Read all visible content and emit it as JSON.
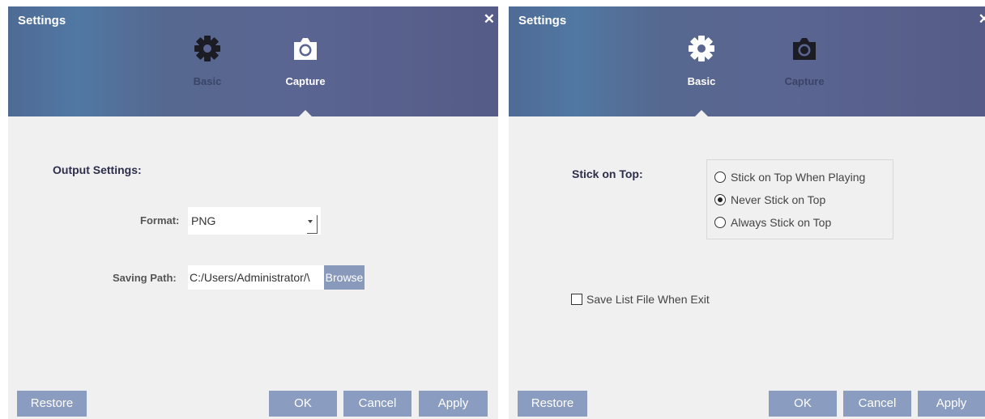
{
  "left": {
    "title": "Settings",
    "close_label": "✕",
    "tabs": [
      {
        "label": "Basic",
        "icon": "gear-icon",
        "active": false
      },
      {
        "label": "Capture",
        "icon": "camera-icon",
        "active": true
      }
    ],
    "section_heading": "Output Settings:",
    "format": {
      "label": "Format:",
      "value": "PNG"
    },
    "saving_path": {
      "label": "Saving Path:",
      "value": "C:/Users/Administrator/\\",
      "browse_label": "Browse"
    },
    "buttons": {
      "restore": "Restore",
      "ok": "OK",
      "cancel": "Cancel",
      "apply": "Apply"
    }
  },
  "right": {
    "title": "Settings",
    "close_label": "✕",
    "tabs": [
      {
        "label": "Basic",
        "icon": "gear-icon",
        "active": true
      },
      {
        "label": "Capture",
        "icon": "camera-icon",
        "active": false
      }
    ],
    "stick_on_top": {
      "label": "Stick on Top:",
      "options": [
        {
          "label": "Stick on Top When Playing",
          "selected": false
        },
        {
          "label": "Never Stick on Top",
          "selected": true
        },
        {
          "label": "Always Stick on Top",
          "selected": false
        }
      ]
    },
    "save_list": {
      "label": "Save List File When Exit",
      "checked": false
    },
    "buttons": {
      "restore": "Restore",
      "ok": "OK",
      "cancel": "Cancel",
      "apply": "Apply"
    }
  },
  "colors": {
    "header": "#5a6592",
    "body": "#f0f0f0",
    "button": "#8a9cc0",
    "browse": "#8899bb"
  }
}
